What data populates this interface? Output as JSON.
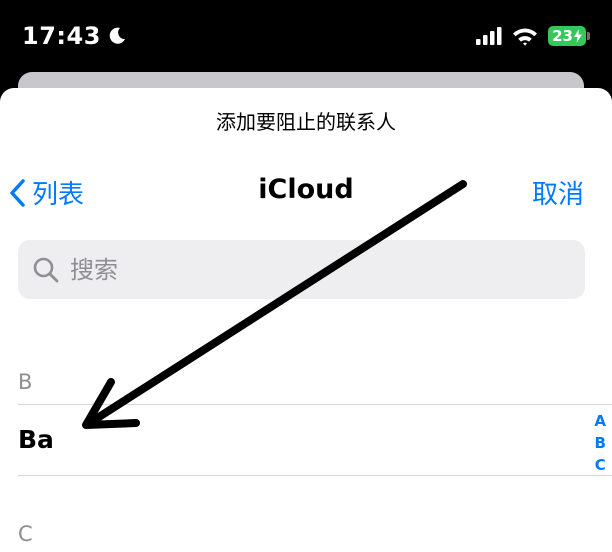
{
  "status_bar": {
    "time": "17:43",
    "battery": "23"
  },
  "sheet": {
    "prompt": "添加要阻止的联系人",
    "nav": {
      "back_label": "列表",
      "title": "iCloud",
      "cancel_label": "取消"
    },
    "search": {
      "placeholder": "搜索",
      "value": ""
    },
    "sections": [
      {
        "letter": "B",
        "contacts": [
          "Ba"
        ]
      },
      {
        "letter": "C",
        "contacts": []
      }
    ],
    "index_letters": [
      "A",
      "B",
      "C"
    ]
  },
  "colors": {
    "accent": "#007aff",
    "battery": "#34c759",
    "search_bg": "#eeeef0",
    "secondary_text": "#8e8e93"
  }
}
